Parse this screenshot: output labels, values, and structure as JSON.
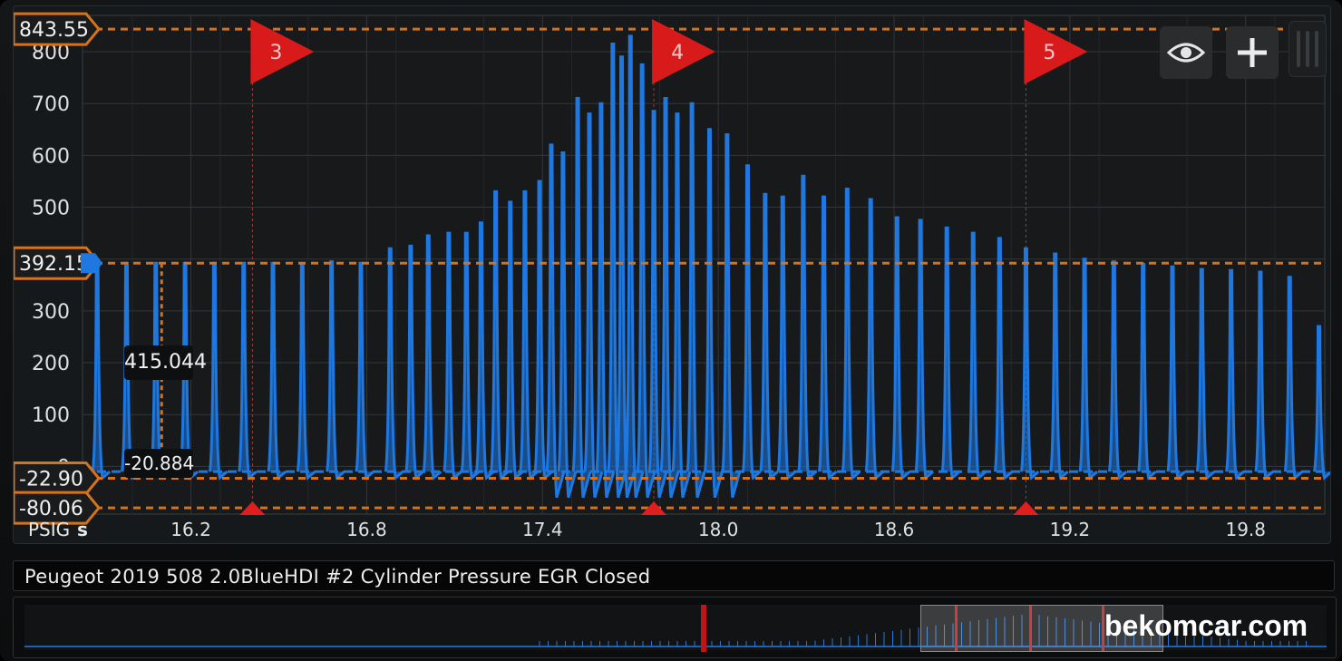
{
  "chart_data": {
    "type": "line",
    "title": "Peugeot 2019 508 2.0BlueHDI #2 Cylinder Pressure EGR Closed",
    "xlabel": "s",
    "ylabel": "PSIG",
    "xlim": [
      15.83,
      20.07
    ],
    "ylim": [
      -92,
      870
    ],
    "x_ticks": [
      "16.2",
      "16.8",
      "17.4",
      "18.0",
      "18.6",
      "19.2",
      "19.8"
    ],
    "y_ticks": [
      "0",
      "100",
      "200",
      "300",
      "400",
      "500",
      "600",
      "700",
      "800"
    ],
    "series": [
      {
        "color": "#1e78e0",
        "peaks_x": [
          15.88,
          15.98,
          16.08,
          16.18,
          16.28,
          16.38,
          16.48,
          16.58,
          16.68,
          16.78,
          16.88,
          16.95,
          17.01,
          17.08,
          17.14,
          17.19,
          17.24,
          17.29,
          17.34,
          17.39,
          17.43,
          17.47,
          17.52,
          17.56,
          17.6,
          17.64,
          17.67,
          17.7,
          17.74,
          17.78,
          17.82,
          17.86,
          17.91,
          17.97,
          18.03,
          18.1,
          18.16,
          18.22,
          18.29,
          18.36,
          18.44,
          18.52,
          18.61,
          18.69,
          18.78,
          18.87,
          18.96,
          19.05,
          19.15,
          19.25,
          19.35,
          19.45,
          19.55,
          19.65,
          19.75,
          19.85,
          19.95,
          20.05
        ],
        "peaks_y": [
          390,
          392,
          392,
          392,
          392,
          392,
          392,
          390,
          395,
          392,
          420,
          425,
          445,
          450,
          450,
          470,
          530,
          510,
          530,
          550,
          620,
          605,
          710,
          680,
          700,
          815,
          790,
          830,
          775,
          685,
          710,
          680,
          700,
          650,
          640,
          580,
          525,
          520,
          560,
          520,
          535,
          515,
          480,
          475,
          460,
          450,
          440,
          420,
          410,
          400,
          395,
          390,
          385,
          380,
          378,
          375,
          365,
          270
        ],
        "baseline": -10
      }
    ],
    "grid": true,
    "legend": "none"
  },
  "axis": {
    "unit_label": "PSIG",
    "x_unit": "s",
    "y_ticks": [
      "0",
      "100",
      "200",
      "300",
      "400",
      "500",
      "600",
      "700",
      "800"
    ],
    "x_ticks": [
      "16.2",
      "16.8",
      "17.4",
      "18.0",
      "18.6",
      "19.2",
      "19.8"
    ]
  },
  "cursors": {
    "h_levels": [
      {
        "label": "843.55",
        "value": 843.55
      },
      {
        "label": "392.15",
        "value": 392.15
      },
      {
        "label": "-22.90",
        "value": -22.9
      },
      {
        "label": "-80.06",
        "value": -80.06
      }
    ],
    "markers": [
      {
        "label": "3",
        "x": 16.41
      },
      {
        "label": "4",
        "x": 17.78
      },
      {
        "label": "5",
        "x": 19.05
      }
    ],
    "readout_high": "415.044",
    "readout_low": "-20.884",
    "readout_x": 16.1
  },
  "toolbar": {
    "visibility_icon": "eye-icon",
    "add_icon": "plus-icon"
  },
  "trace_title": "Peugeot 2019 508 2.0BlueHDI #2 Cylinder Pressure EGR Closed",
  "overview": {
    "markers_frac": [
      0.51,
      0.7,
      0.76,
      0.82
    ]
  },
  "watermark": "bekomcar.com",
  "colors": {
    "trace": "#1e78e0",
    "cursor": "#d4731c",
    "marker": "#e01e1e",
    "grid": "#33373b"
  }
}
